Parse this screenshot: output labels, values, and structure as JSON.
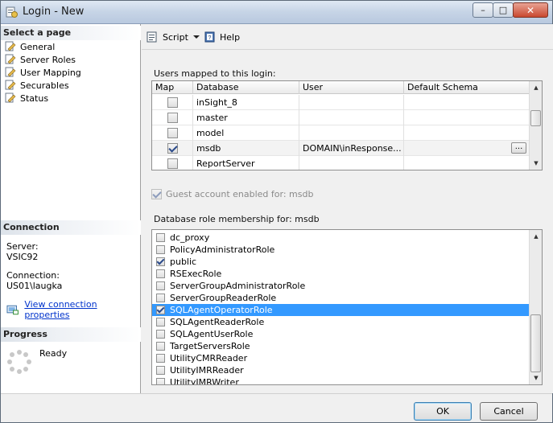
{
  "window": {
    "title": "Login - New",
    "min_label": "–",
    "max_label": "□",
    "close_label": "✕"
  },
  "left": {
    "select_page_header": "Select a page",
    "pages": [
      {
        "label": "General",
        "icon": "page-icon"
      },
      {
        "label": "Server Roles",
        "icon": "page-icon"
      },
      {
        "label": "User Mapping",
        "icon": "page-icon"
      },
      {
        "label": "Securables",
        "icon": "page-icon"
      },
      {
        "label": "Status",
        "icon": "page-icon"
      }
    ],
    "connection_header": "Connection",
    "server_label": "Server:",
    "server_value": "VSIC92",
    "connection_label": "Connection:",
    "connection_value": "US01\\laugka",
    "view_props_link": "View connection properties",
    "progress_header": "Progress",
    "progress_status": "Ready"
  },
  "toolbar": {
    "script_label": "Script",
    "help_label": "Help"
  },
  "mapping": {
    "label": "Users mapped to this login:",
    "columns": [
      "Map",
      "Database",
      "User",
      "Default Schema"
    ],
    "rows": [
      {
        "map": false,
        "database": "inSight_8",
        "user": "",
        "schema": ""
      },
      {
        "map": false,
        "database": "master",
        "user": "",
        "schema": ""
      },
      {
        "map": false,
        "database": "model",
        "user": "",
        "schema": ""
      },
      {
        "map": true,
        "database": "msdb",
        "user": "DOMAIN\\inResponse...",
        "schema": "",
        "ellipsis": "..."
      },
      {
        "map": false,
        "database": "ReportServer",
        "user": "",
        "schema": ""
      }
    ]
  },
  "guest": {
    "label": "Guest account enabled for: msdb",
    "checked": true,
    "enabled": false
  },
  "roles": {
    "label": "Database role membership for: msdb",
    "items": [
      {
        "name": "dc_proxy",
        "checked": false
      },
      {
        "name": "PolicyAdministratorRole",
        "checked": false
      },
      {
        "name": "public",
        "checked": true
      },
      {
        "name": "RSExecRole",
        "checked": false
      },
      {
        "name": "ServerGroupAdministratorRole",
        "checked": false
      },
      {
        "name": "ServerGroupReaderRole",
        "checked": false
      },
      {
        "name": "SQLAgentOperatorRole",
        "checked": true,
        "selected": true
      },
      {
        "name": "SQLAgentReaderRole",
        "checked": false
      },
      {
        "name": "SQLAgentUserRole",
        "checked": false
      },
      {
        "name": "TargetServersRole",
        "checked": false
      },
      {
        "name": "UtilityCMRReader",
        "checked": false
      },
      {
        "name": "UtilityIMRReader",
        "checked": false
      },
      {
        "name": "UtilityIMRWriter",
        "checked": false
      }
    ]
  },
  "footer": {
    "ok_label": "OK",
    "cancel_label": "Cancel"
  },
  "colors": {
    "selection": "#3399ff",
    "link": "#0033cc"
  }
}
